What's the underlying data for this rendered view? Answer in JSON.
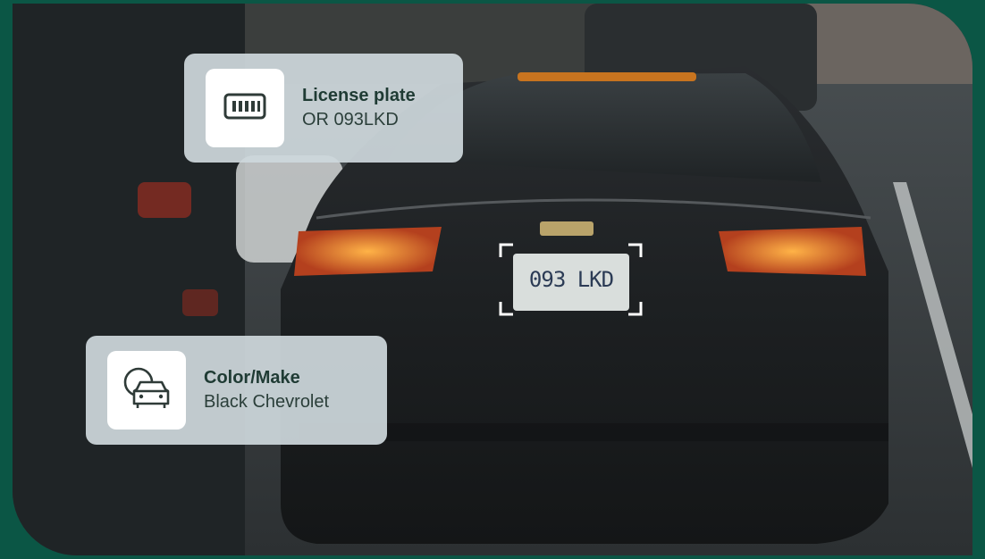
{
  "photo": {
    "plate_text": "093 LKD",
    "description_icon": "car-photo"
  },
  "cards": {
    "license_plate": {
      "title": "License plate",
      "value": "OR 093LKD",
      "icon": "license-plate-icon"
    },
    "color_make": {
      "title": "Color/Make",
      "value": "Black Chevrolet",
      "icon": "car-color-icon"
    }
  },
  "colors": {
    "background": "#0b5645",
    "card": "#ced7db",
    "card_text": "#1f3b34",
    "icon_stroke": "#2f3b38"
  }
}
